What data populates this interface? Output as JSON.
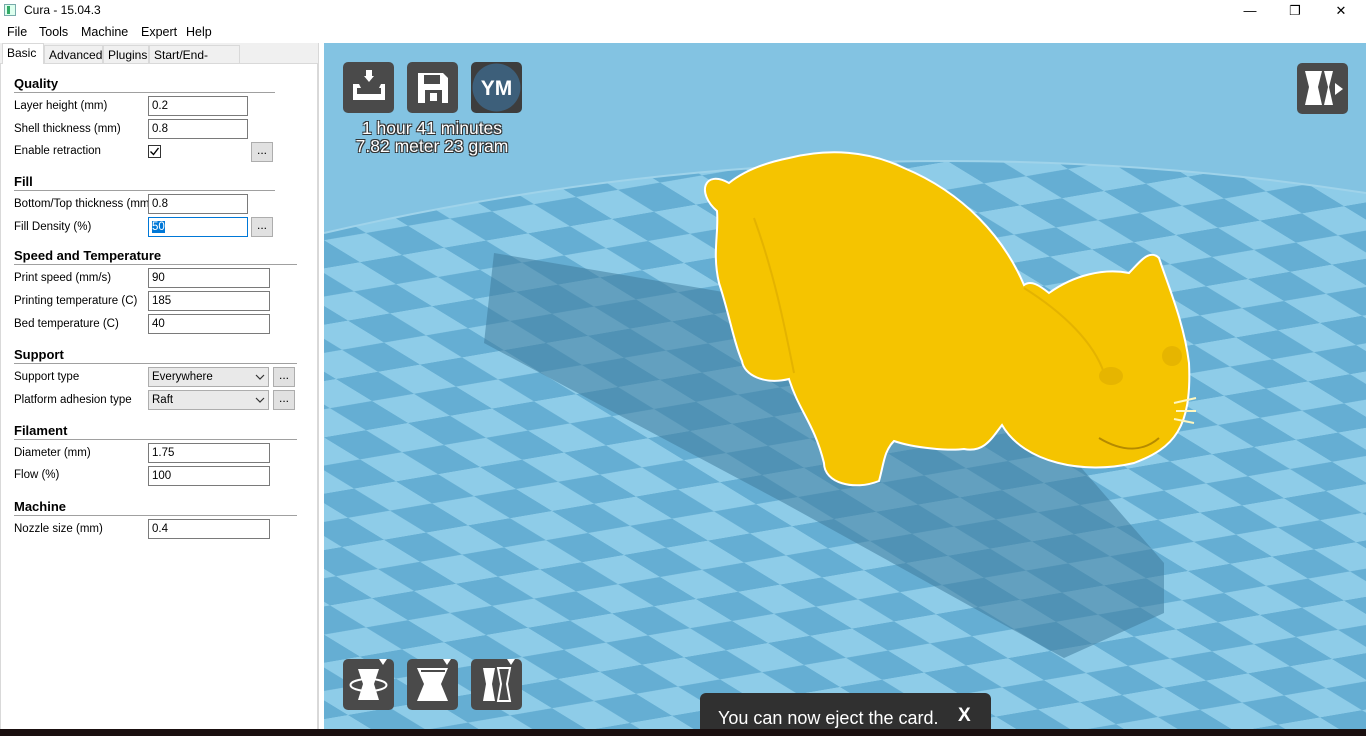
{
  "window": {
    "title": "Cura - 15.04.3",
    "minimize_glyph": "—",
    "maximize_glyph": "❐",
    "close_glyph": "✕"
  },
  "menu": [
    "File",
    "Tools",
    "Machine",
    "Expert",
    "Help"
  ],
  "tabs": [
    "Basic",
    "Advanced",
    "Plugins",
    "Start/End-GCode"
  ],
  "sections": {
    "quality": {
      "title": "Quality",
      "layer_height": {
        "label": "Layer height (mm)",
        "value": "0.2"
      },
      "shell_thickness": {
        "label": "Shell thickness (mm)",
        "value": "0.8"
      },
      "enable_retraction": {
        "label": "Enable retraction",
        "checked": true
      }
    },
    "fill": {
      "title": "Fill",
      "bottom_top_thickness": {
        "label": "Bottom/Top thickness (mm)",
        "value": "0.8"
      },
      "fill_density": {
        "label": "Fill Density (%)",
        "value": "50"
      }
    },
    "speed": {
      "title": "Speed and Temperature",
      "print_speed": {
        "label": "Print speed (mm/s)",
        "value": "90"
      },
      "printing_temperature": {
        "label": "Printing temperature (C)",
        "value": "185"
      },
      "bed_temperature": {
        "label": "Bed temperature (C)",
        "value": "40"
      }
    },
    "support": {
      "title": "Support",
      "support_type": {
        "label": "Support type",
        "value": "Everywhere"
      },
      "platform_adhesion": {
        "label": "Platform adhesion type",
        "value": "Raft"
      }
    },
    "filament": {
      "title": "Filament",
      "diameter": {
        "label": "Diameter (mm)",
        "value": "1.75"
      },
      "flow": {
        "label": "Flow (%)",
        "value": "100"
      }
    },
    "machine": {
      "title": "Machine",
      "nozzle_size": {
        "label": "Nozzle size (mm)",
        "value": "0.4"
      }
    }
  },
  "dots_label": "...",
  "viewport": {
    "user_initials": "YM",
    "print_time": "1 hour 41 minutes",
    "print_material": "7.82 meter 23 gram",
    "model_color": "#f5c400",
    "bed_color_light": "#8dcbe8",
    "bed_color_dark": "#62acd2"
  },
  "notification": {
    "message": "You can now eject the card.",
    "close": "X"
  }
}
